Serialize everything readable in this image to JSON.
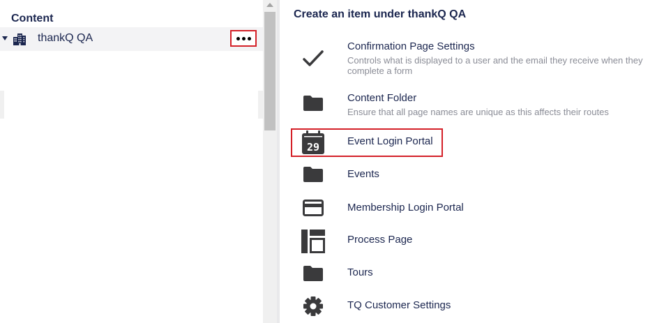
{
  "tree": {
    "heading": "Content",
    "root": {
      "label": "thankQ QA"
    }
  },
  "create": {
    "title": "Create an item under thankQ QA",
    "items": [
      {
        "name": "Confirmation Page Settings",
        "description": "Controls what is displayed to a user and the email they receive when they complete a form",
        "icon": "checkmark-icon"
      },
      {
        "name": "Content Folder",
        "description": "Ensure that all page names are unique as this affects their routes",
        "icon": "folder-icon"
      },
      {
        "name": "Event Login Portal",
        "description": "",
        "icon": "calendar-icon",
        "icon_text": "29"
      },
      {
        "name": "Events",
        "description": "",
        "icon": "folder-icon"
      },
      {
        "name": "Membership Login Portal",
        "description": "",
        "icon": "card-icon"
      },
      {
        "name": "Process Page",
        "description": "",
        "icon": "layout-icon"
      },
      {
        "name": "Tours",
        "description": "",
        "icon": "folder-icon"
      },
      {
        "name": "TQ Customer Settings",
        "description": "",
        "icon": "gear-icon"
      }
    ]
  },
  "colors": {
    "text": "#1b264f",
    "description": "#8a8c96",
    "highlight": "#d42028",
    "icon": "#3a3a3c"
  }
}
